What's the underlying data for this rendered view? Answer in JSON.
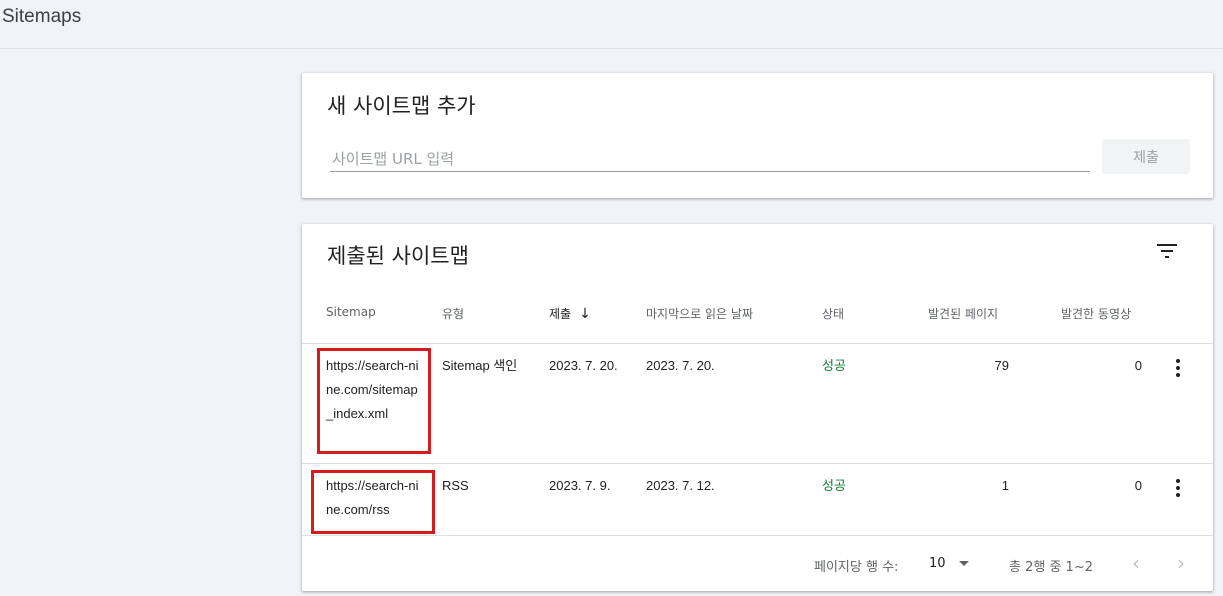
{
  "page": {
    "title": "Sitemaps"
  },
  "add_card": {
    "heading": "새 사이트맵 추가",
    "input_placeholder": "사이트맵 URL 입력",
    "input_value": "",
    "submit_label": "제출"
  },
  "list_card": {
    "heading": "제출된 사이트맵",
    "columns": {
      "sitemap": "Sitemap",
      "type": "유형",
      "submitted": "제출",
      "last_read": "마지막으로 읽은 날짜",
      "status": "상태",
      "pages_found": "발견된 페이지",
      "videos_found": "발견한 동영상"
    },
    "rows": [
      {
        "sitemap": "https://search-nine.com/sitemap_index.xml",
        "type": "Sitemap 색인",
        "submitted": "2023. 7. 20.",
        "last_read": "2023. 7. 20.",
        "status": "성공",
        "pages_found": "79",
        "videos_found": "0"
      },
      {
        "sitemap": "https://search-nine.com/rss",
        "type": "RSS",
        "submitted": "2023. 7. 9.",
        "last_read": "2023. 7. 12.",
        "status": "성공",
        "pages_found": "1",
        "videos_found": "0"
      }
    ],
    "footer": {
      "rows_per_page_label": "페이지당 행 수:",
      "rows_per_page_value": "10",
      "range_text": "총 2행 중 1~2",
      "prev_icon": "chevron-left-icon",
      "next_icon": "chevron-right-icon"
    }
  },
  "colors": {
    "status_success": "#188038",
    "highlight_border": "#d71920",
    "background": "#f1f3f9"
  },
  "icons": {
    "filter": "filter-icon",
    "sort": "arrow-down-icon",
    "row_menu": "more-vert-icon"
  }
}
